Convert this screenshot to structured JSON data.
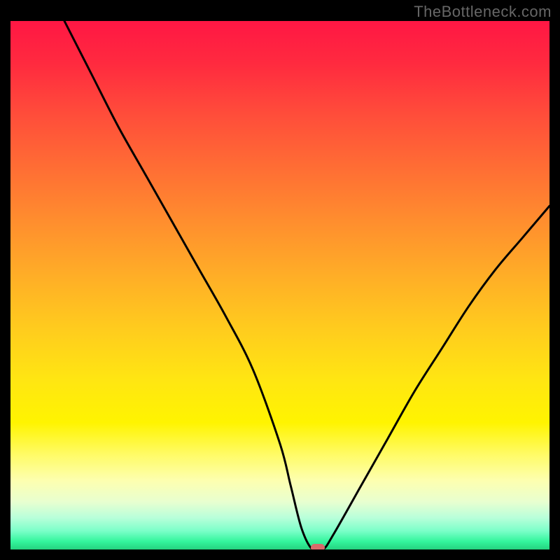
{
  "watermark": "TheBottleneck.com",
  "colors": {
    "top": "#ff1744",
    "mid": "#ffcc00",
    "bottom": "#25d27f",
    "curve": "#000000",
    "marker": "#d86b6b",
    "frame": "#000000"
  },
  "chart_data": {
    "type": "line",
    "title": "",
    "xlabel": "",
    "ylabel": "",
    "x_range": [
      0,
      100
    ],
    "y_range": [
      0,
      100
    ],
    "curve": {
      "x": [
        10,
        15,
        20,
        25,
        30,
        35,
        40,
        45,
        50,
        52,
        54,
        56,
        58,
        60,
        65,
        70,
        75,
        80,
        85,
        90,
        95,
        100
      ],
      "y": [
        100,
        90,
        80,
        71,
        62,
        53,
        44,
        34,
        20,
        12,
        4,
        0,
        0,
        3,
        12,
        21,
        30,
        38,
        46,
        53,
        59,
        65
      ]
    },
    "minimum_marker": {
      "x": 57,
      "y": 0
    },
    "annotations": []
  }
}
